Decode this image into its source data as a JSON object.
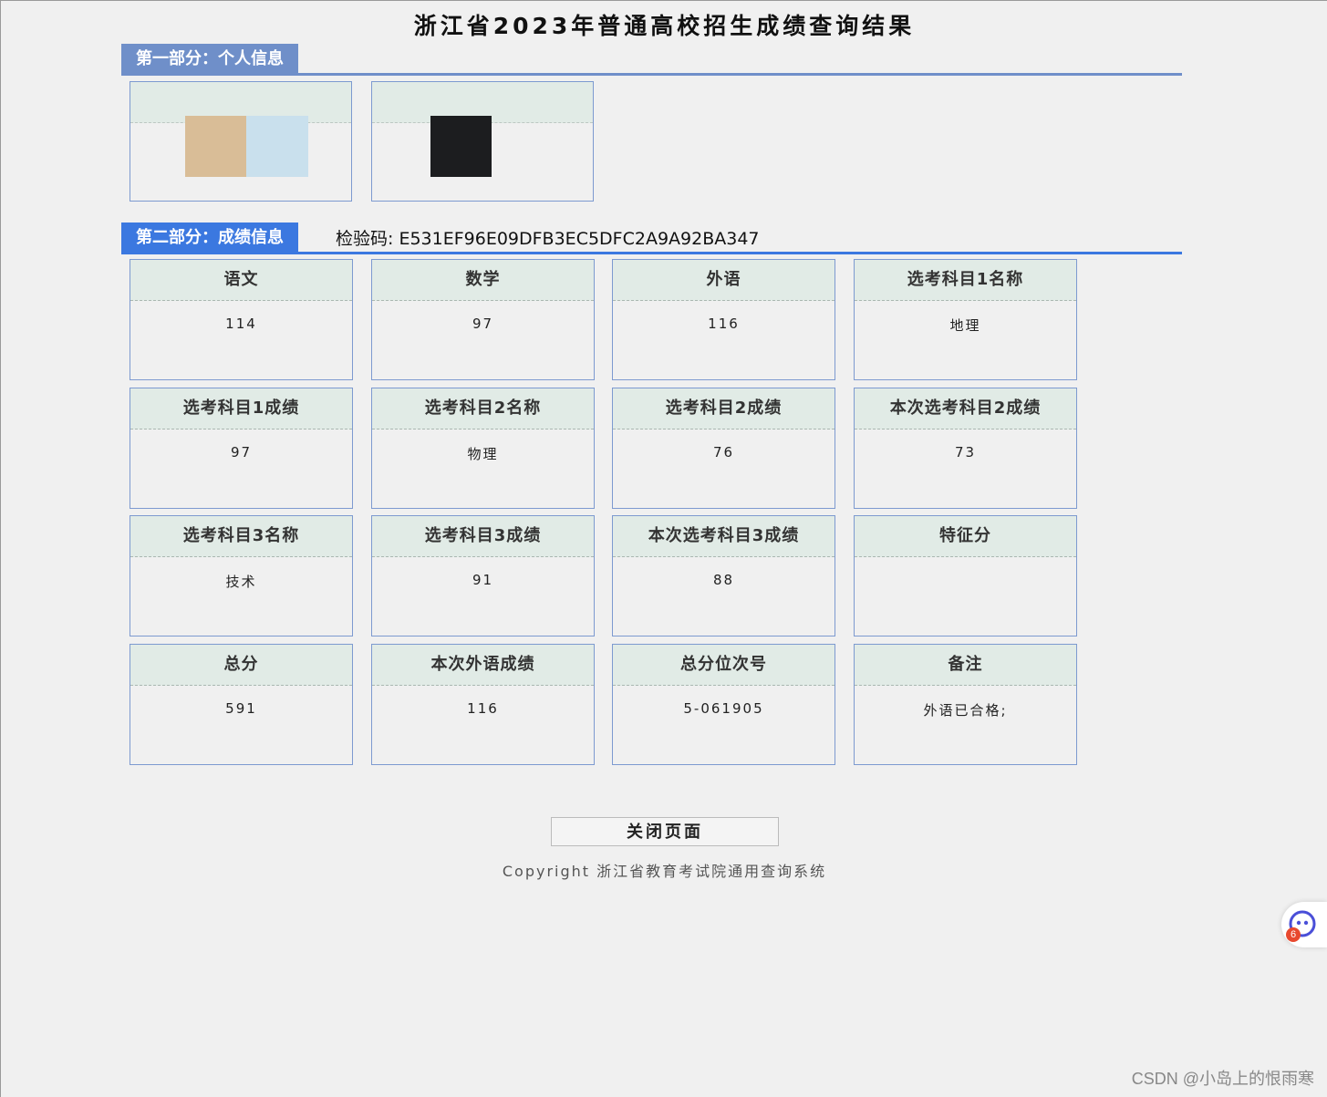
{
  "page": {
    "title": "浙江省2023年普通高校招生成绩查询结果"
  },
  "section1": {
    "label": "第一部分：个人信息"
  },
  "section2": {
    "label": "第二部分：成绩信息",
    "check_code": "检验码: E531EF96E09DFB3EC5DFC2A9A92BA347"
  },
  "scores": [
    {
      "label": "语文",
      "value": "114"
    },
    {
      "label": "数学",
      "value": "97"
    },
    {
      "label": "外语",
      "value": "116"
    },
    {
      "label": "选考科目1名称",
      "value": "地理"
    },
    {
      "label": "选考科目1成绩",
      "value": "97"
    },
    {
      "label": "选考科目2名称",
      "value": "物理"
    },
    {
      "label": "选考科目2成绩",
      "value": "76"
    },
    {
      "label": "本次选考科目2成绩",
      "value": "73"
    },
    {
      "label": "选考科目3名称",
      "value": "技术"
    },
    {
      "label": "选考科目3成绩",
      "value": "91"
    },
    {
      "label": "本次选考科目3成绩",
      "value": "88"
    },
    {
      "label": "特征分",
      "value": ""
    },
    {
      "label": "总分",
      "value": "591"
    },
    {
      "label": "本次外语成绩",
      "value": "116"
    },
    {
      "label": "总分位次号",
      "value": "5-061905"
    },
    {
      "label": "备注",
      "value": "外语已合格;"
    }
  ],
  "footer": {
    "close_button": "关闭页面",
    "copyright": "Copyright 浙江省教育考试院通用查询系统"
  },
  "overlay": {
    "watermark": "CSDN @小岛上的恨雨寒",
    "widget_badge": "6"
  },
  "colors": {
    "section1_accent": "#6f8fc9",
    "section2_accent": "#3b78e0",
    "card_header_bg": "#e1ebe6",
    "card_border": "#7d9ad0"
  }
}
